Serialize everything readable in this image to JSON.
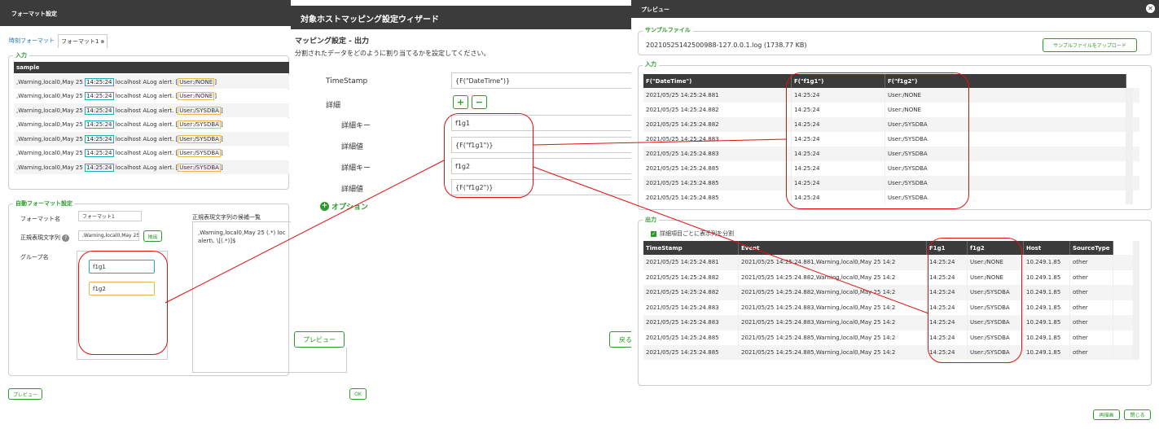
{
  "left": {
    "title": "フォーマット設定",
    "tabs": [
      "時刻フォーマット",
      "フォーマット1"
    ],
    "input_legend": "入力",
    "sample_header": "sample",
    "sample_rows": [
      {
        "pre": ",Warning,local0,May 25 ",
        "time": "14:25:24",
        "mid": " localhost ALog alert. [",
        "user": "User:/NONE",
        "post": "]"
      },
      {
        "pre": ",Warning,local0,May 25 ",
        "time": "14:25:24",
        "mid": " localhost ALog alert. [",
        "user": "User:/NONE",
        "post": "]"
      },
      {
        "pre": ",Warning,local0,May 25 ",
        "time": "14:25:24",
        "mid": " localhost ALog alert. [",
        "user": "User:/SYSDBA",
        "post": "]"
      },
      {
        "pre": ",Warning,local0,May 25 ",
        "time": "14:25:24",
        "mid": " localhost ALog alert. [",
        "user": "User:/SYSDBA",
        "post": "]"
      },
      {
        "pre": ",Warning,local0,May 25 ",
        "time": "14:25:24",
        "mid": " localhost ALog alert. [",
        "user": "User:/SYSDBA",
        "post": "]"
      },
      {
        "pre": ",Warning,local0,May 25 ",
        "time": "14:25:24",
        "mid": " localhost ALog alert. [",
        "user": "User:/SYSDBA",
        "post": "]"
      },
      {
        "pre": ",Warning,local0,May 25 ",
        "time": "14:25:24",
        "mid": " localhost ALog alert. [",
        "user": "User:/SYSDBA",
        "post": "]"
      }
    ],
    "auto_legend": "自動フォーマット設定",
    "format_name_label": "フォーマット名",
    "format_name_value": "フォーマット1",
    "regex_label": "正規表現文字列",
    "regex_value": ",Warning,local0,May 25",
    "extract_button": "抽出",
    "group_label": "グループ名",
    "groups": [
      "f1g1",
      "f1g2"
    ],
    "candidates_label": "正規表現文字列の候補一覧",
    "candidate_text1": ",Warning,local0,May 25 (.*) loc",
    "candidate_text2": "alert\\. \\[(.*)]$",
    "preview_button": "プレビュー",
    "ok_button": "OK"
  },
  "wizard": {
    "title": "対象ホストマッピング設定ウィザード",
    "section": "マッピング設定 - 出力",
    "desc": "分割されたデータをどのように割り当てるかを設定してください。",
    "timestamp_label": "TimeStamp",
    "timestamp_value": "{F(\"DateTime\")}",
    "detail_label": "詳細",
    "plus": "+",
    "minus": "−",
    "key_label": "詳細キー",
    "val_label": "詳細値",
    "key1": "f1g1",
    "val1": "{F(\"f1g1\")}",
    "key2": "f1g2",
    "val2": "{F(\"f1g2\")}",
    "option_label": "オプション",
    "preview_button": "プレビュー",
    "back_button": "戻る"
  },
  "preview": {
    "title": "プレビュー",
    "sample_legend": "サンプルファイル",
    "file_name": "20210525142500988-127.0.0.1.log (1738.77 KB)",
    "upload_button": "サンプルファイルをアップロード",
    "input_legend": "入力",
    "input_headers": [
      "F(\"DateTime\")",
      "F(\"f1g1\")",
      "F(\"f1g2\")"
    ],
    "input_rows": [
      [
        "2021/05/25 14:25:24.881",
        "14:25:24",
        "User:/NONE"
      ],
      [
        "2021/05/25 14:25:24.882",
        "14:25:24",
        "User:/NONE"
      ],
      [
        "2021/05/25 14:25:24.882",
        "14:25:24",
        "User:/SYSDBA"
      ],
      [
        "2021/05/25 14:25:24.883",
        "14:25:24",
        "User:/SYSDBA"
      ],
      [
        "2021/05/25 14:25:24.883",
        "14:25:24",
        "User:/SYSDBA"
      ],
      [
        "2021/05/25 14:25:24.885",
        "14:25:24",
        "User:/SYSDBA"
      ],
      [
        "2021/05/25 14:25:24.885",
        "14:25:24",
        "User:/SYSDBA"
      ],
      [
        "2021/05/25 14:25:24.885",
        "14:25:24",
        "User:/SYSDBA"
      ]
    ],
    "output_legend": "出力",
    "split_checkbox_label": "詳細項目ごとに表示列を分割",
    "output_headers": [
      "TimeStamp",
      "Event",
      "F1g1",
      "f1g2",
      "Host",
      "SourceType"
    ],
    "output_rows": [
      [
        "2021/05/25 14:25:24.881",
        "2021/05/25 14:25:24.881,Warning,local0,May 25 14:2",
        "14:25:24",
        "User:/NONE",
        "10.249.1.85",
        "other"
      ],
      [
        "2021/05/25 14:25:24.882",
        "2021/05/25 14:25:24.882,Warning,local0,May 25 14:2",
        "14:25:24",
        "User:/NONE",
        "10.249.1.85",
        "other"
      ],
      [
        "2021/05/25 14:25:24.882",
        "2021/05/25 14:25:24.882,Warning,local0,May 25 14:2",
        "14:25:24",
        "User:/SYSDBA",
        "10.249.1.85",
        "other"
      ],
      [
        "2021/05/25 14:25:24.883",
        "2021/05/25 14:25:24.883,Warning,local0,May 25 14:2",
        "14:25:24",
        "User:/SYSDBA",
        "10.249.1.85",
        "other"
      ],
      [
        "2021/05/25 14:25:24.883",
        "2021/05/25 14:25:24.883,Warning,local0,May 25 14:2",
        "14:25:24",
        "User:/SYSDBA",
        "10.249.1.85",
        "other"
      ],
      [
        "2021/05/25 14:25:24.885",
        "2021/05/25 14:25:24.885,Warning,local0,May 25 14:2",
        "14:25:24",
        "User:/SYSDBA",
        "10.249.1.85",
        "other"
      ],
      [
        "2021/05/25 14:25:24.885",
        "2021/05/25 14:25:24.885,Warning,local0,May 25 14:2",
        "14:25:24",
        "User:/SYSDBA",
        "10.249.1.85",
        "other"
      ]
    ],
    "redisplay_button": "再描画",
    "close_button": "閉じる"
  },
  "colors": {
    "accent": "#2a9a2a",
    "header": "#3b3b3b",
    "highlight_red": "#e01010",
    "tag_blue": "#22aabb",
    "tag_yellow": "#e8b84a"
  }
}
